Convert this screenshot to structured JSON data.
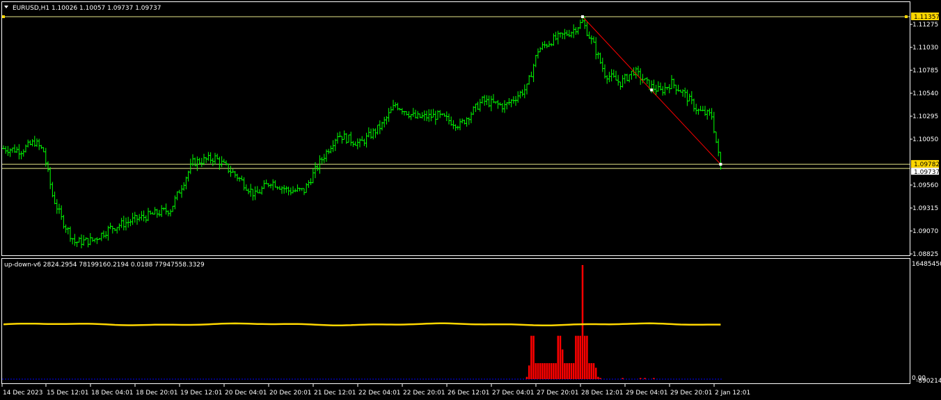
{
  "header": {
    "menu_icon": "triangle-down-icon",
    "symbol_info": "EURUSD,H1  1.10026 1.10057 1.09737 1.09737"
  },
  "indicator": {
    "label": "up-down-v6 2824.2954 78199160.2194 0.0188 77947558.3329",
    "scale_top": "16485450",
    "scale_bottom": "0.00",
    "scale_bottom_overlap": "-890214."
  },
  "colors": {
    "background": "#000000",
    "frame": "#ffffff",
    "candle": "#00ff00",
    "hline": "#e8e88a",
    "hline_marker": "#ffd700",
    "trendline": "#ff0000",
    "indicator_line": "#ffd700",
    "histogram": "#ff0000",
    "baseline": "#0000ff"
  },
  "chart_data": {
    "type": "candlestick",
    "timeframe": "H1",
    "price_axis_ticks": [
      "1.11275",
      "1.11030",
      "1.10785",
      "1.10540",
      "1.10295",
      "1.10050",
      "1.09560",
      "1.09315",
      "1.09070",
      "1.08825"
    ],
    "price_axis_values": [
      1.11275,
      1.1103,
      1.10785,
      1.1054,
      1.10295,
      1.1005,
      1.0956,
      1.09315,
      1.0907,
      1.08825
    ],
    "price_labels": [
      {
        "text": "1.11357",
        "value": 1.11357,
        "style": "highlight"
      },
      {
        "text": "1.09782",
        "value": 1.09782,
        "style": "highlight"
      },
      {
        "text": "1.09737",
        "value": 1.09737,
        "style": "current"
      }
    ],
    "time_axis": [
      "14 Dec 2023",
      "15 Dec 12:01",
      "18 Dec 04:01",
      "18 Dec 20:01",
      "19 Dec 12:01",
      "20 Dec 04:01",
      "20 Dec 20:01",
      "21 Dec 12:01",
      "22 Dec 04:01",
      "22 Dec 20:01",
      "26 Dec 12:01",
      "27 Dec 04:01",
      "27 Dec 20:01",
      "28 Dec 12:01",
      "29 Dec 04:01",
      "29 Dec 20:01",
      "2 Jan 12:01"
    ],
    "horizontal_lines": [
      1.11357,
      1.09782,
      1.09737
    ],
    "trendline": {
      "from_bar": 260,
      "from_price": 1.11357,
      "to_bar": 322,
      "to_price": 1.09782,
      "mid_bar": 291,
      "mid_price": 1.10575
    },
    "anchors": [
      {
        "bar": 0,
        "price": 1.0995
      },
      {
        "bar": 8,
        "price": 1.0993
      },
      {
        "bar": 14,
        "price": 1.1002
      },
      {
        "bar": 18,
        "price": 1.0992
      },
      {
        "bar": 22,
        "price": 1.0945
      },
      {
        "bar": 26,
        "price": 1.092
      },
      {
        "bar": 32,
        "price": 1.0895
      },
      {
        "bar": 40,
        "price": 1.0897
      },
      {
        "bar": 48,
        "price": 1.091
      },
      {
        "bar": 60,
        "price": 1.092
      },
      {
        "bar": 75,
        "price": 1.093
      },
      {
        "bar": 85,
        "price": 1.098
      },
      {
        "bar": 95,
        "price": 1.0985
      },
      {
        "bar": 105,
        "price": 1.0965
      },
      {
        "bar": 113,
        "price": 1.0945
      },
      {
        "bar": 120,
        "price": 1.096
      },
      {
        "bar": 128,
        "price": 1.095
      },
      {
        "bar": 135,
        "price": 1.095
      },
      {
        "bar": 142,
        "price": 1.098
      },
      {
        "bar": 150,
        "price": 1.101
      },
      {
        "bar": 160,
        "price": 1.1
      },
      {
        "bar": 170,
        "price": 1.102
      },
      {
        "bar": 176,
        "price": 1.1042
      },
      {
        "bar": 185,
        "price": 1.1028
      },
      {
        "bar": 195,
        "price": 1.103
      },
      {
        "bar": 205,
        "price": 1.102
      },
      {
        "bar": 215,
        "price": 1.1046
      },
      {
        "bar": 225,
        "price": 1.104
      },
      {
        "bar": 235,
        "price": 1.106
      },
      {
        "bar": 240,
        "price": 1.11
      },
      {
        "bar": 246,
        "price": 1.111
      },
      {
        "bar": 255,
        "price": 1.112
      },
      {
        "bar": 260,
        "price": 1.113
      },
      {
        "bar": 265,
        "price": 1.1105
      },
      {
        "bar": 270,
        "price": 1.1075
      },
      {
        "bar": 277,
        "price": 1.1065
      },
      {
        "bar": 283,
        "price": 1.1078
      },
      {
        "bar": 290,
        "price": 1.1062
      },
      {
        "bar": 295,
        "price": 1.1056
      },
      {
        "bar": 300,
        "price": 1.1065
      },
      {
        "bar": 305,
        "price": 1.1055
      },
      {
        "bar": 312,
        "price": 1.1035
      },
      {
        "bar": 318,
        "price": 1.103
      },
      {
        "bar": 322,
        "price": 1.0974
      }
    ],
    "indicator_histogram": [
      {
        "bar": 235,
        "value": 0.02
      },
      {
        "bar": 236,
        "value": 0.12
      },
      {
        "bar": 237,
        "value": 0.38
      },
      {
        "bar": 238,
        "value": 0.38
      },
      {
        "bar": 239,
        "value": 0.14
      },
      {
        "bar": 240,
        "value": 0.14
      },
      {
        "bar": 241,
        "value": 0.14
      },
      {
        "bar": 242,
        "value": 0.14
      },
      {
        "bar": 243,
        "value": 0.14
      },
      {
        "bar": 244,
        "value": 0.14
      },
      {
        "bar": 245,
        "value": 0.14
      },
      {
        "bar": 246,
        "value": 0.14
      },
      {
        "bar": 247,
        "value": 0.14
      },
      {
        "bar": 248,
        "value": 0.14
      },
      {
        "bar": 249,
        "value": 0.38
      },
      {
        "bar": 250,
        "value": 0.38
      },
      {
        "bar": 251,
        "value": 0.26
      },
      {
        "bar": 252,
        "value": 0.14
      },
      {
        "bar": 253,
        "value": 0.14
      },
      {
        "bar": 254,
        "value": 0.14
      },
      {
        "bar": 255,
        "value": 0.14
      },
      {
        "bar": 256,
        "value": 0.14
      },
      {
        "bar": 257,
        "value": 0.38
      },
      {
        "bar": 258,
        "value": 0.38
      },
      {
        "bar": 259,
        "value": 0.38
      },
      {
        "bar": 260,
        "value": 1.0
      },
      {
        "bar": 261,
        "value": 0.38
      },
      {
        "bar": 262,
        "value": 0.38
      },
      {
        "bar": 263,
        "value": 0.14
      },
      {
        "bar": 264,
        "value": 0.14
      },
      {
        "bar": 265,
        "value": 0.14
      },
      {
        "bar": 266,
        "value": 0.1
      },
      {
        "bar": 267,
        "value": 0.02
      },
      {
        "bar": 268,
        "value": 0.01
      },
      {
        "bar": 278,
        "value": 0.01
      },
      {
        "bar": 286,
        "value": 0.01
      },
      {
        "bar": 288,
        "value": 0.01
      },
      {
        "bar": 292,
        "value": 0.01
      }
    ],
    "indicator_line_level": 0.48
  }
}
